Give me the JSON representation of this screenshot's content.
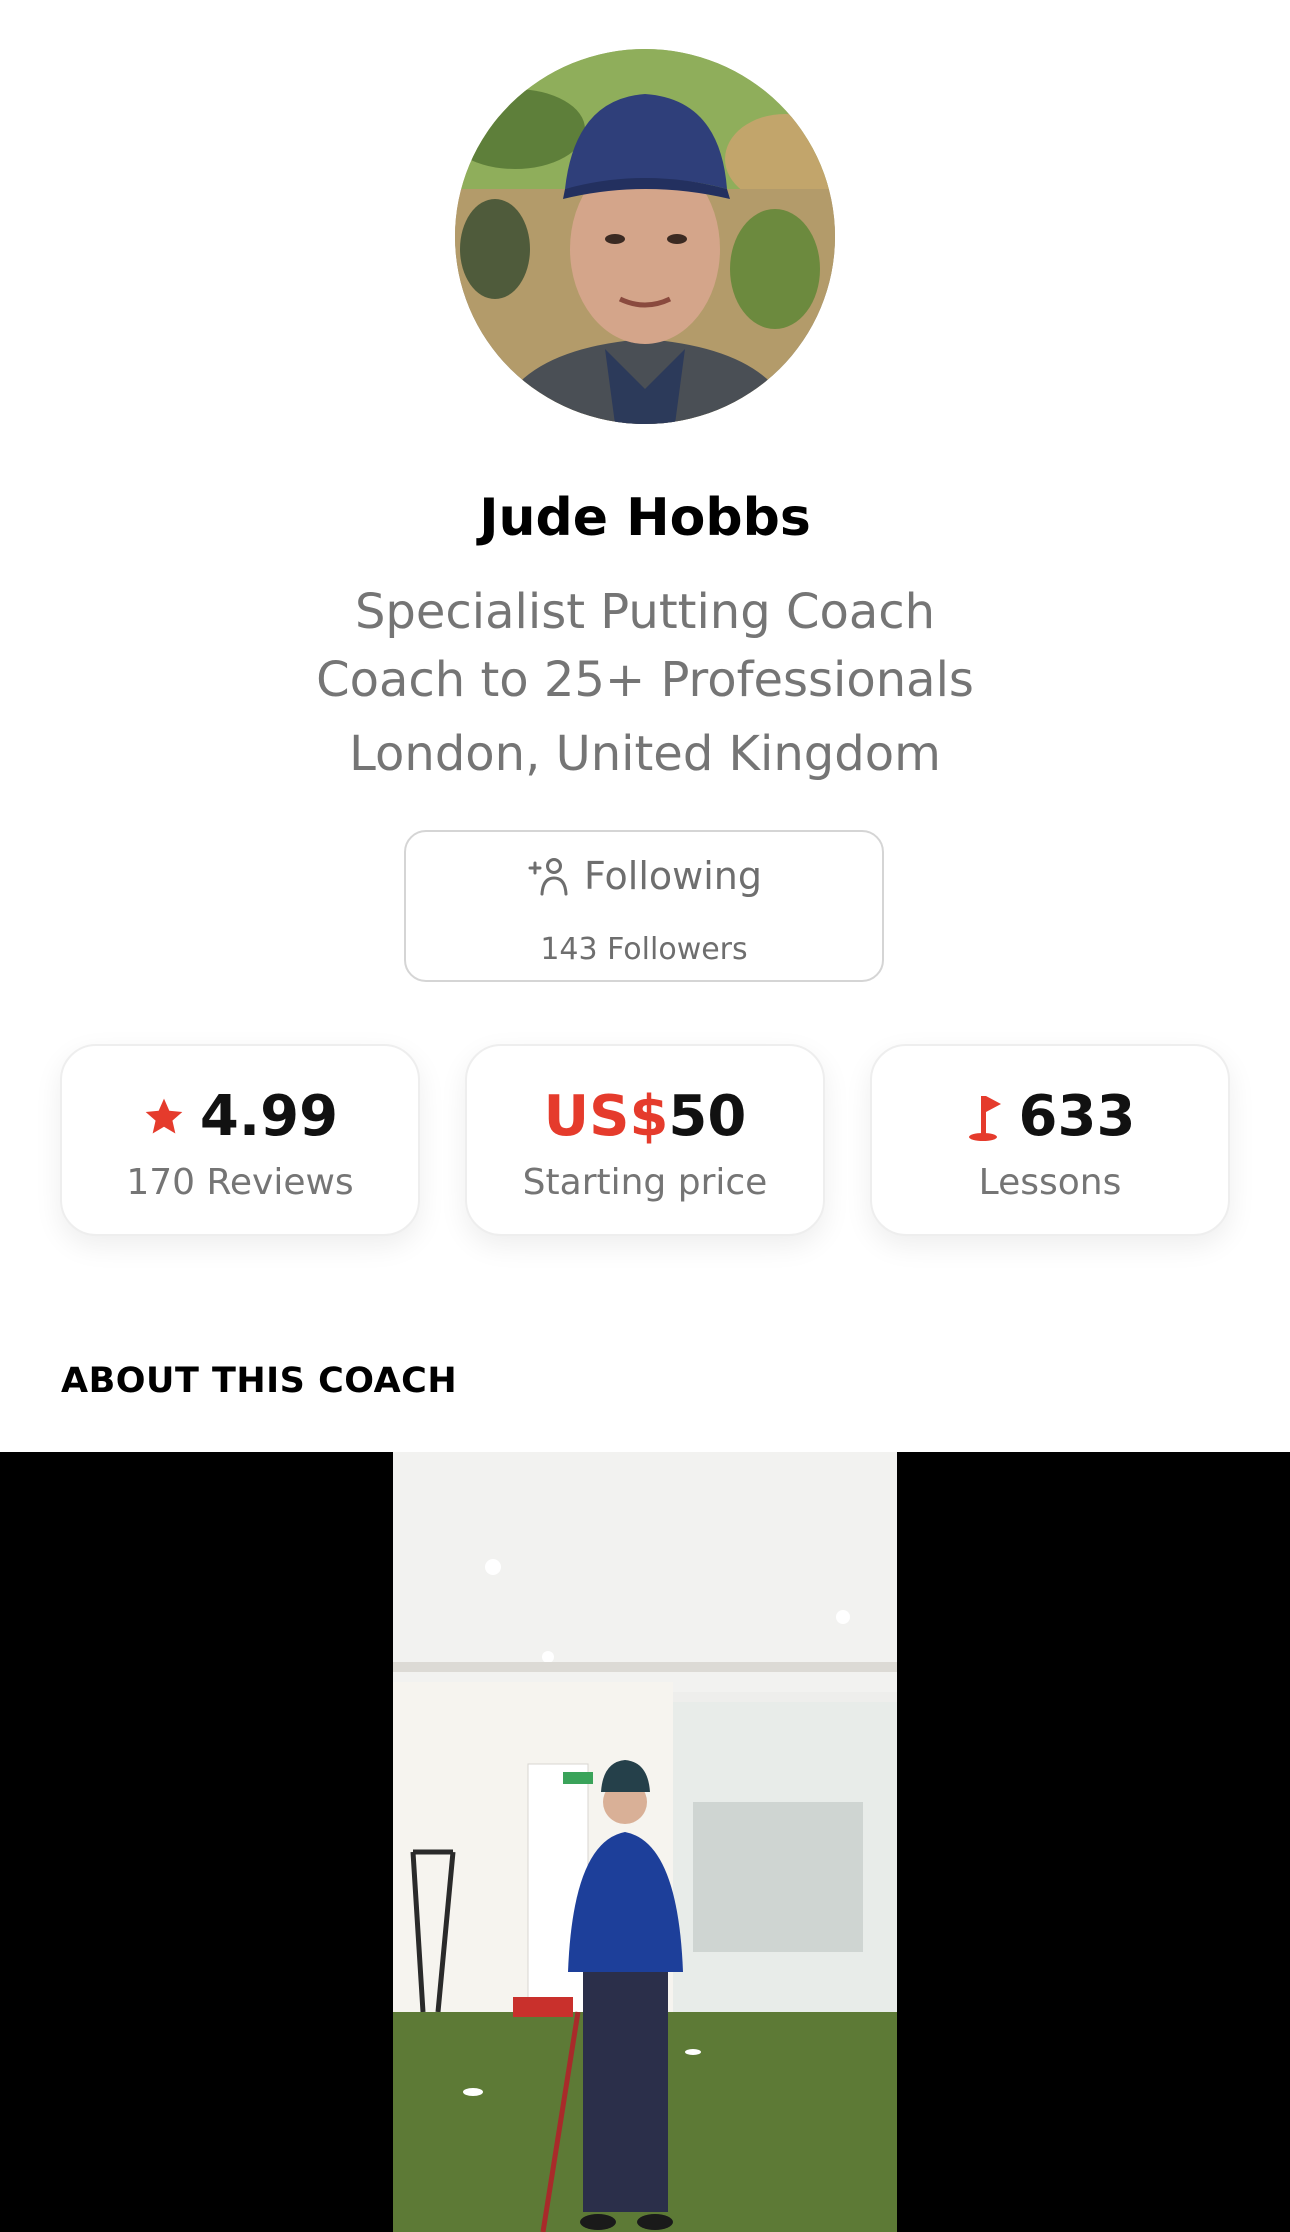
{
  "coach": {
    "name": "Jude Hobbs",
    "tagline_line1": "Specialist Putting Coach",
    "tagline_line2": "Coach to 25+ Professionals",
    "location": "London, United Kingdom"
  },
  "follow": {
    "label": "Following",
    "followers": "143 Followers",
    "icon": "person-plus-icon"
  },
  "stats": {
    "rating": {
      "value": "4.99",
      "label": "170 Reviews",
      "icon": "star-icon"
    },
    "price": {
      "currency": "US$",
      "value": "50",
      "label": "Starting price"
    },
    "lessons": {
      "value": "633",
      "label": "Lessons",
      "icon": "golf-flag-icon"
    }
  },
  "about": {
    "heading": "ABOUT THIS COACH"
  },
  "colors": {
    "accent": "#e53b2c",
    "muted_text": "#757575",
    "border": "#d5d5d5"
  }
}
